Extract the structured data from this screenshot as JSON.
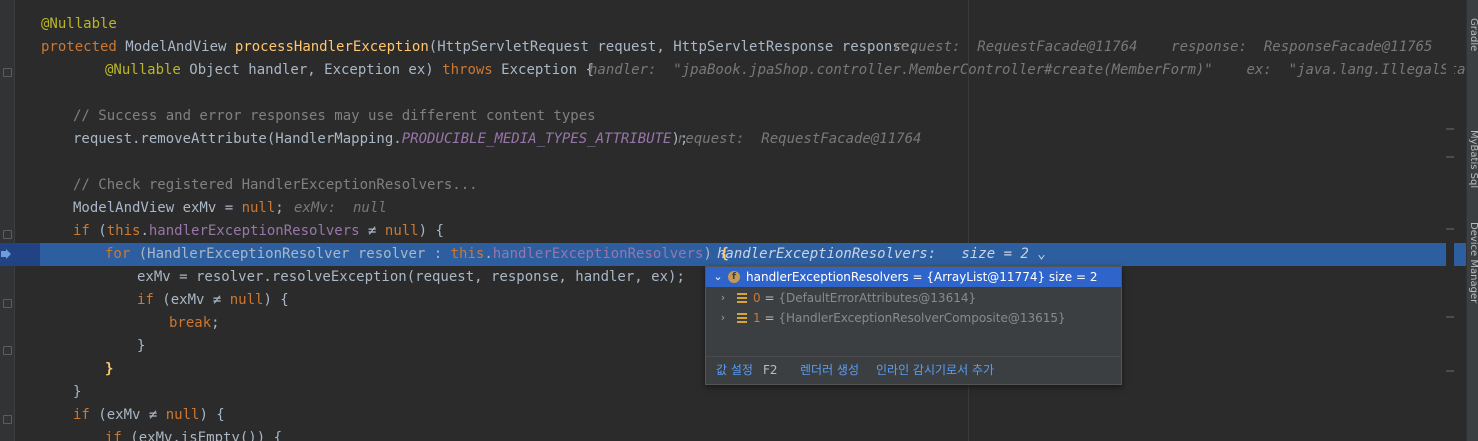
{
  "code": {
    "l1": {
      "annotation": "@Nullable"
    },
    "l2": {
      "kw": "protected",
      "type": "ModelAndView",
      "method": "processHandlerException",
      "params": "(HttpServletRequest request, HttpServletResponse response,",
      "inline": "request:  RequestFacade@11764    response:  ResponseFacade@11765"
    },
    "l3": {
      "annotation": "@Nullable",
      "params": " Object handler, Exception ex) ",
      "kw": "throws",
      "rest": " Exception {",
      "inline": "handler:  \"jpaBook.jpaShop.controller.MemberController#create(MemberForm)\"    ex:  \"java.lang.IllegalStateExcep"
    },
    "l5": {
      "comment": "// Success and error responses may use different content types"
    },
    "l6": {
      "pre": "request.removeAttribute(HandlerMapping.",
      "field": "PRODUCIBLE_MEDIA_TYPES_ATTRIBUTE",
      "post": ");",
      "inline": "request:  RequestFacade@11764"
    },
    "l8": {
      "comment": "// Check registered HandlerExceptionResolvers..."
    },
    "l9": {
      "pre": "ModelAndView exMv = ",
      "kw": "null",
      "post": ";",
      "inline": "exMv:  null"
    },
    "l10": {
      "kw_if": "if",
      "p1": " (",
      "kw_this": "this",
      "dot": ".",
      "field": "handlerExceptionResolvers",
      "ne": " ≠ ",
      "kw_null": "null",
      "post": ") {"
    },
    "l11": {
      "kw_for": "for",
      "p1": " (HandlerExceptionResolver resolver : ",
      "kw_this": "this",
      "dot": ".",
      "field": "handlerExceptionResolvers",
      "post": ") ",
      "brace": "{",
      "inline": "handlerExceptionResolvers:   size = 2 ⌄"
    },
    "l12": {
      "text": "exMv = resolver.resolveException(request, response, handler, ex);"
    },
    "l13": {
      "kw_if": "if",
      "pre": " (exMv ≠ ",
      "kw_null": "null",
      "post": ") {"
    },
    "l14": {
      "kw": "break",
      "post": ";"
    },
    "l15": {
      "text": "}"
    },
    "l16": {
      "brace": "}"
    },
    "l17": {
      "text": "}"
    },
    "l18": {
      "kw_if": "if",
      "pre": " (exMv ≠ ",
      "kw_null": "null",
      "post": ") {"
    },
    "l19": {
      "kw_if": "if",
      "text": " (exMv.isEmpty()) {"
    }
  },
  "popup": {
    "header": "handlerExceptionResolvers = {ArrayList@11774}  size = 2",
    "items": [
      {
        "index": "0",
        "eq": " = ",
        "value": "{DefaultErrorAttributes@13614}"
      },
      {
        "index": "1",
        "eq": " = ",
        "value": "{HandlerExceptionResolverComposite@13615}"
      }
    ],
    "footer": {
      "set_value": "값 설정",
      "set_value_key": "F2",
      "renderer": "렌더러 생성",
      "inline_watch": "인라인 감시기로서 추가"
    }
  },
  "sidebar": {
    "tabs": [
      "Gradle",
      "MyBatis Sql",
      "Device Manager"
    ]
  },
  "colors": {
    "background": "#2b2b2b",
    "highlight": "#2d5fa0",
    "keyword": "#cc7832",
    "method": "#ffc66d",
    "field": "#9876aa",
    "popup_selected": "#2f65ca"
  }
}
